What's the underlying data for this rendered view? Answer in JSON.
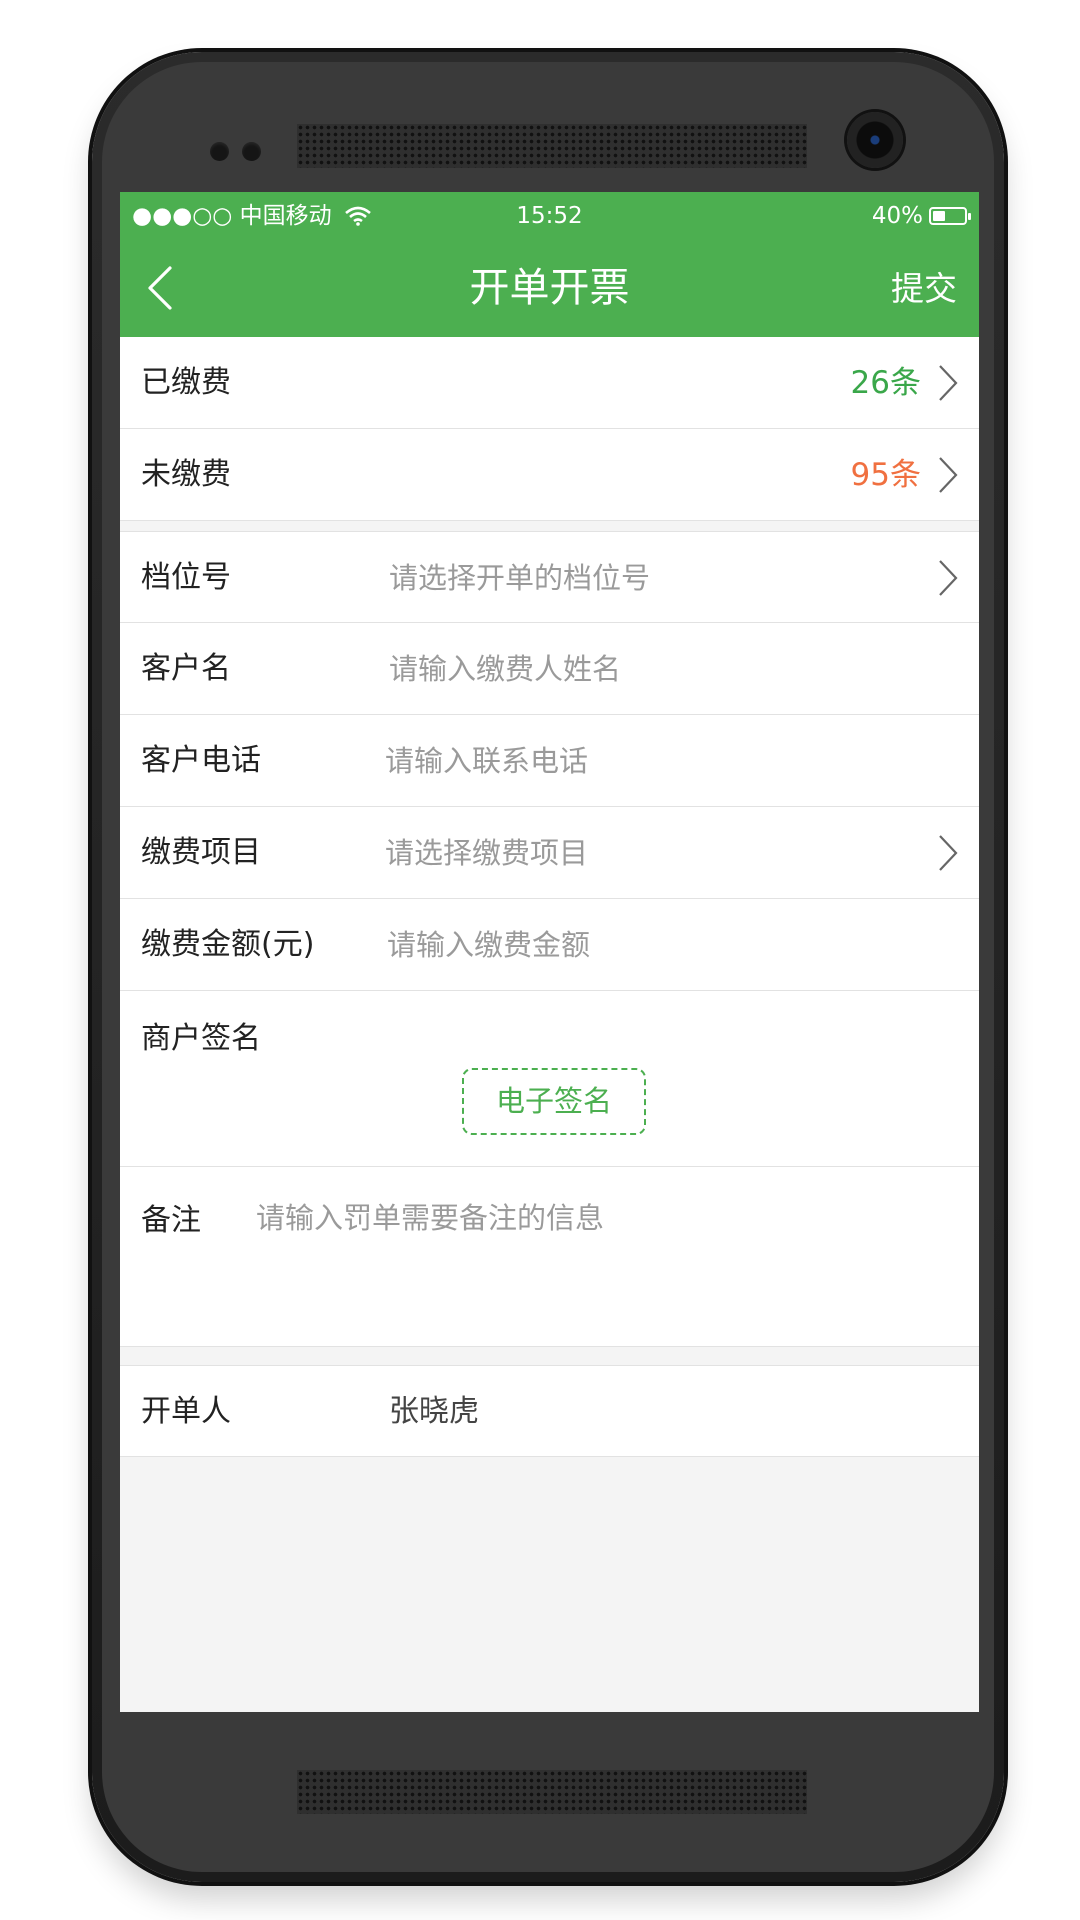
{
  "status_bar": {
    "carrier": "●●●○○ 中国移动",
    "time": "15:52",
    "battery": "40%",
    "battery_level": 0.4
  },
  "nav": {
    "title": "开单开票",
    "submit_label": "提交"
  },
  "summary": {
    "paid": {
      "label": "已缴费",
      "count": "26条",
      "color": "#3aa74a"
    },
    "unpaid": {
      "label": "未缴费",
      "count": "95条",
      "color": "#f07040"
    }
  },
  "form": {
    "stall": {
      "label": "档位号",
      "placeholder": "请选择开单的档位号"
    },
    "customer_name": {
      "label": "客户名",
      "placeholder": "请输入缴费人姓名"
    },
    "customer_phone": {
      "label": "客户电话",
      "placeholder": "请输入联系电话"
    },
    "fee_item": {
      "label": "缴费项目",
      "placeholder": "请选择缴费项目"
    },
    "fee_amount": {
      "label": "缴费金额(元)",
      "placeholder": "请输入缴费金额"
    },
    "signature": {
      "label": "商户签名",
      "button": "电子签名"
    },
    "remark": {
      "label": "备注",
      "placeholder": "请输入罚单需要备注的信息"
    }
  },
  "issuer": {
    "label": "开单人",
    "value": "张晓虎"
  },
  "colors": {
    "accent": "#4caf50",
    "text": "#222222",
    "placeholder": "#9a9a9a"
  }
}
